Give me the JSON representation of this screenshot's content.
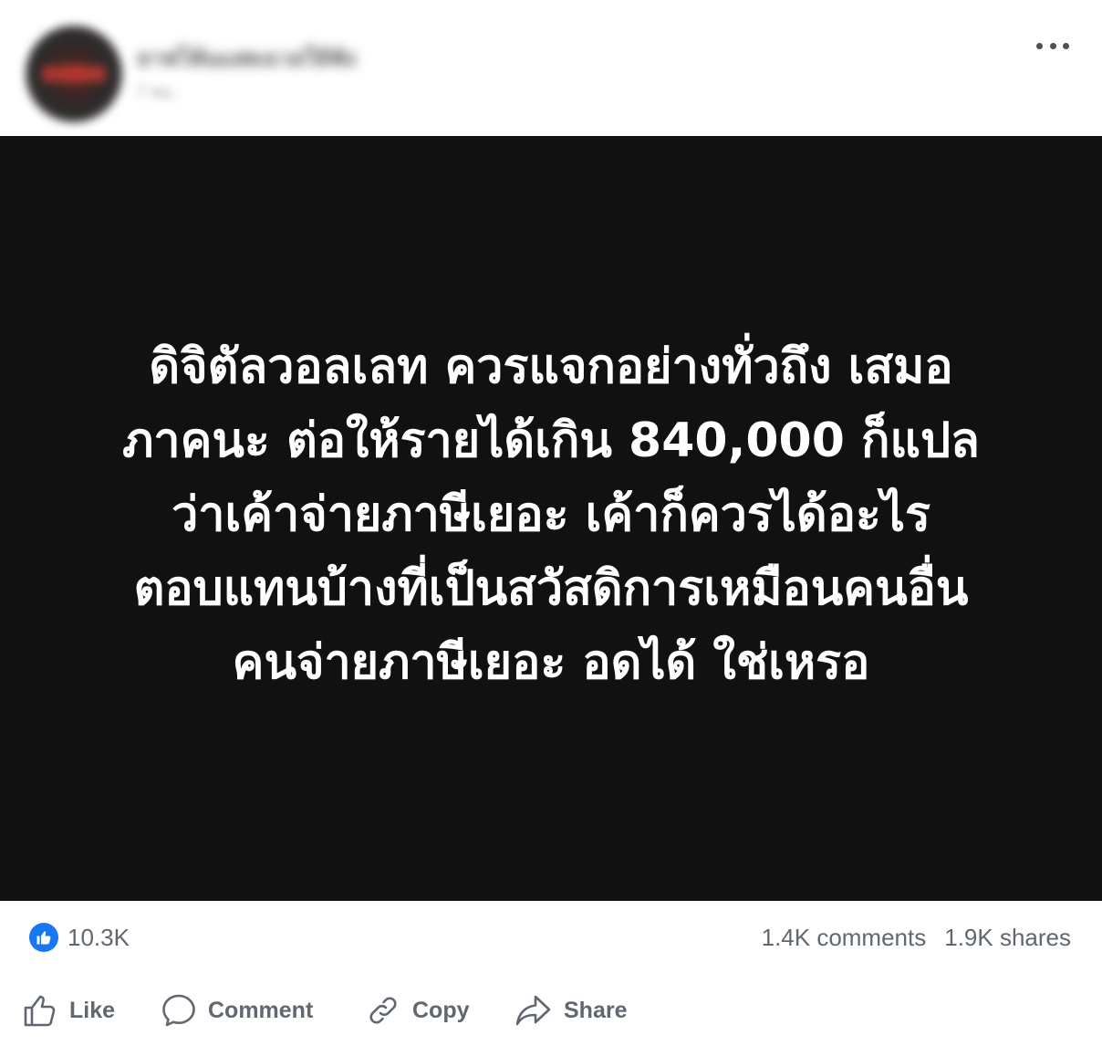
{
  "header": {
    "author_name": "ลาฟโพ้นแสดงเวลให้ฟัง",
    "timestamp": "7 ชม."
  },
  "card": {
    "lines": [
      "ดิจิตัลวอลเลท ควรแจกอย่างทั่วถึง เสมอ",
      "ภาคนะ ต่อให้รายได้เกิน 840,000 ก็แปล",
      "ว่าเค้าจ่ายภาษีเยอะ เค้าก็ควรได้อะไร",
      "ตอบแทนบ้างที่เป็นสวัสดิการเหมือนคนอื่น",
      "คนจ่ายภาษีเยอะ อดได้ ใช่เหรอ"
    ]
  },
  "stats": {
    "likes": "10.3K",
    "comments": "1.4K comments",
    "shares": "1.9K shares"
  },
  "actions": {
    "like": "Like",
    "comment": "Comment",
    "copy": "Copy",
    "share": "Share"
  },
  "icons": [
    "more-icon",
    "like-badge-icon",
    "thumbs-up-icon",
    "comment-icon",
    "link-icon",
    "share-icon"
  ],
  "colors": {
    "like_blue": "#1877f2",
    "card_background": "#111111",
    "secondary_text": "#606770"
  }
}
